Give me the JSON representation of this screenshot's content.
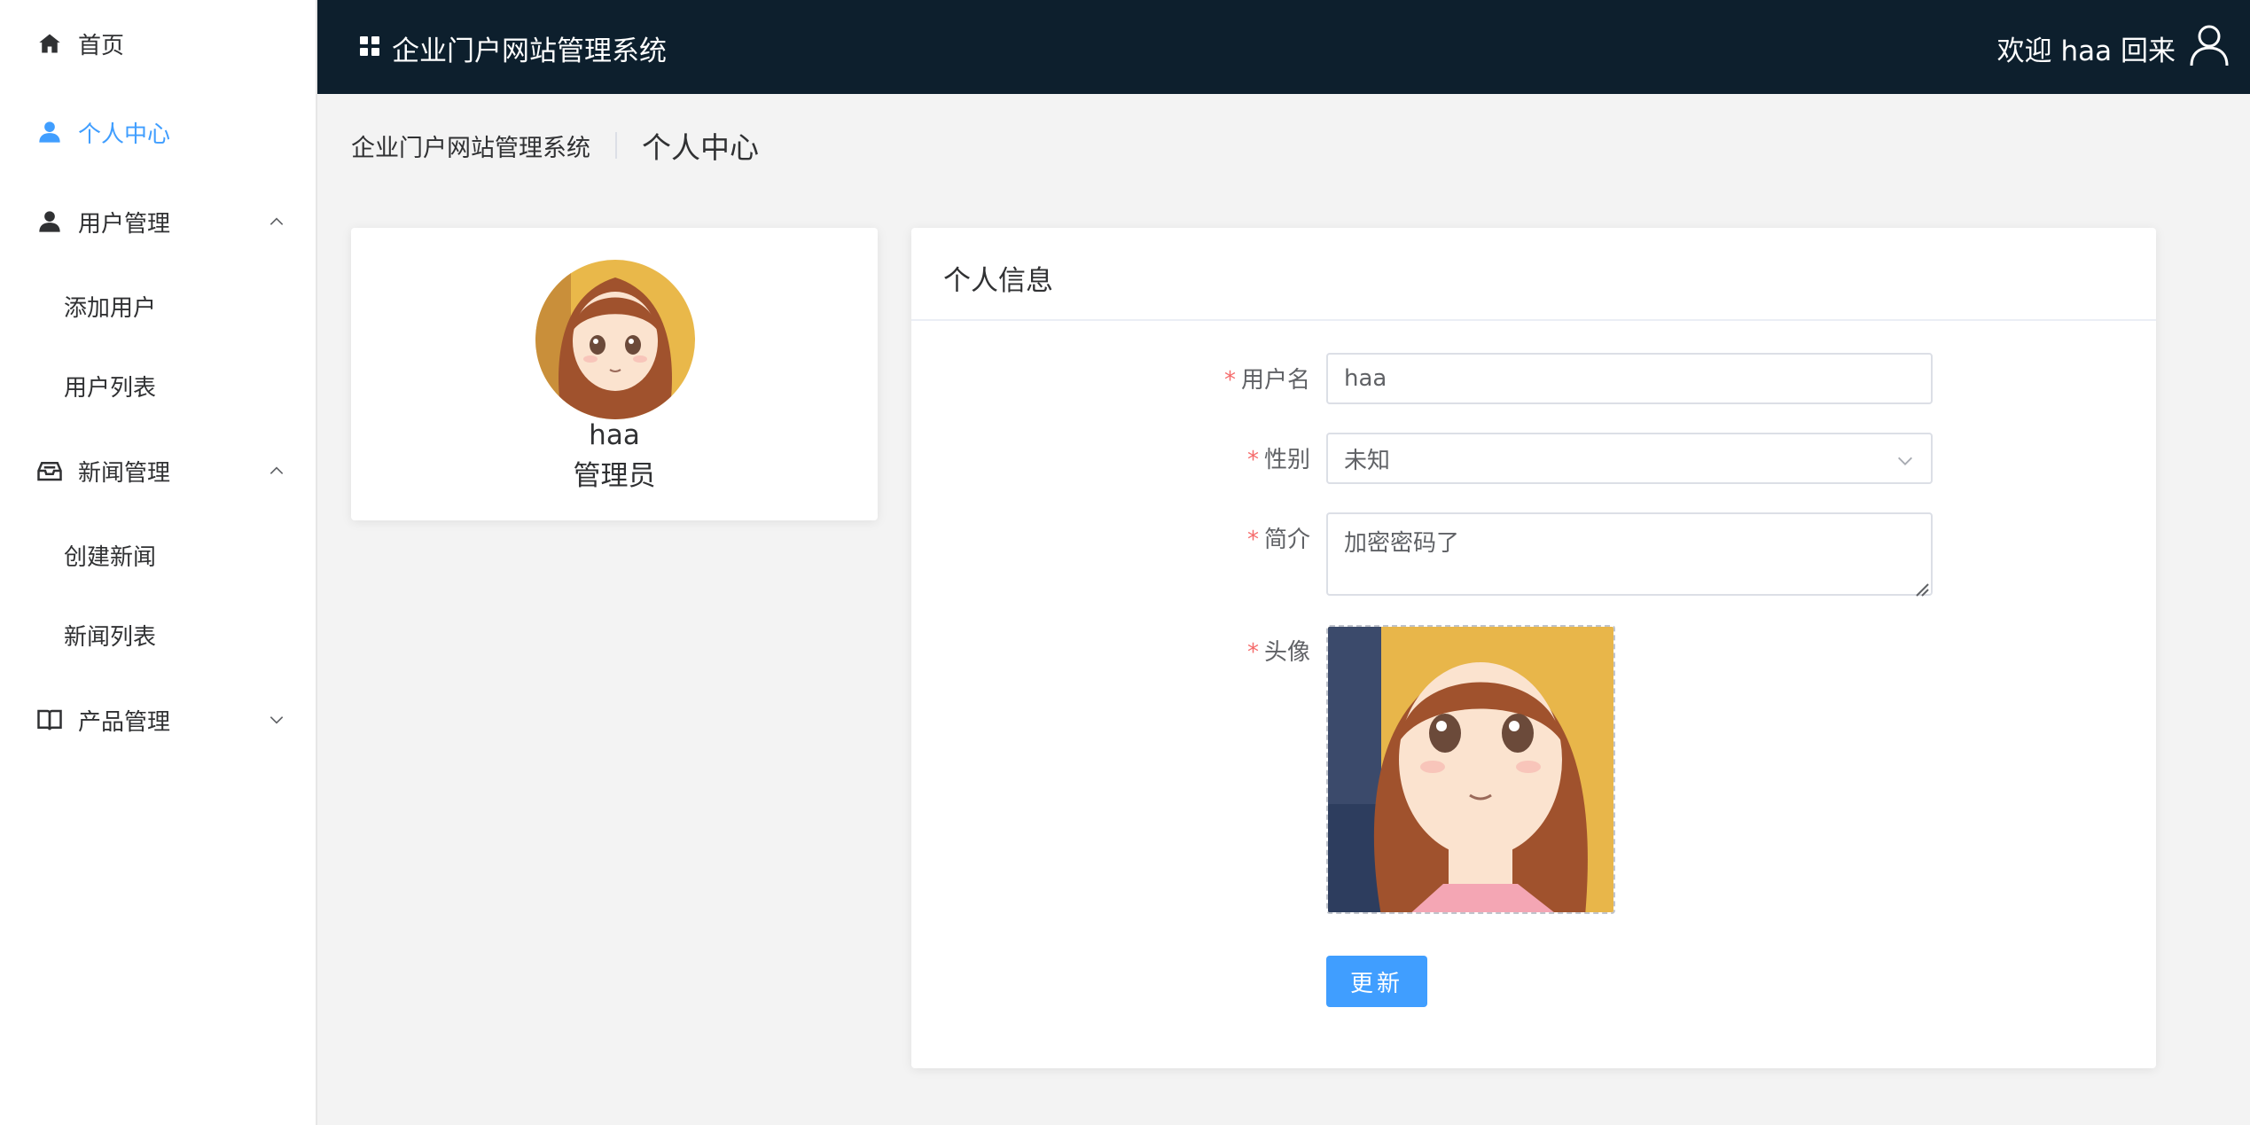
{
  "header": {
    "app_title": "企业门户网站管理系统",
    "welcome": "欢迎 haa 回来"
  },
  "sidebar": {
    "items": [
      {
        "label": "首页",
        "icon": "home-icon"
      },
      {
        "label": "个人中心",
        "icon": "user-icon",
        "active": true
      },
      {
        "label": "用户管理",
        "icon": "user-icon",
        "expanded": true,
        "children": [
          {
            "label": "添加用户"
          },
          {
            "label": "用户列表"
          }
        ]
      },
      {
        "label": "新闻管理",
        "icon": "inbox-icon",
        "expanded": true,
        "children": [
          {
            "label": "创建新闻"
          },
          {
            "label": "新闻列表"
          }
        ]
      },
      {
        "label": "产品管理",
        "icon": "book-icon",
        "expanded": false
      }
    ]
  },
  "breadcrumb": {
    "root": "企业门户网站管理系统",
    "current": "个人中心"
  },
  "profile": {
    "name": "haa",
    "role": "管理员"
  },
  "info_card": {
    "title": "个人信息",
    "fields": {
      "username": {
        "label": "用户名",
        "value": "haa"
      },
      "gender": {
        "label": "性别",
        "value": "未知"
      },
      "intro": {
        "label": "简介",
        "value": "加密密码了"
      },
      "avatar": {
        "label": "头像"
      }
    },
    "required_mark": "*",
    "submit_label": "更新"
  },
  "colors": {
    "accent": "#409eff",
    "header_bg": "#0d1f2d",
    "required": "#f56c6c"
  }
}
